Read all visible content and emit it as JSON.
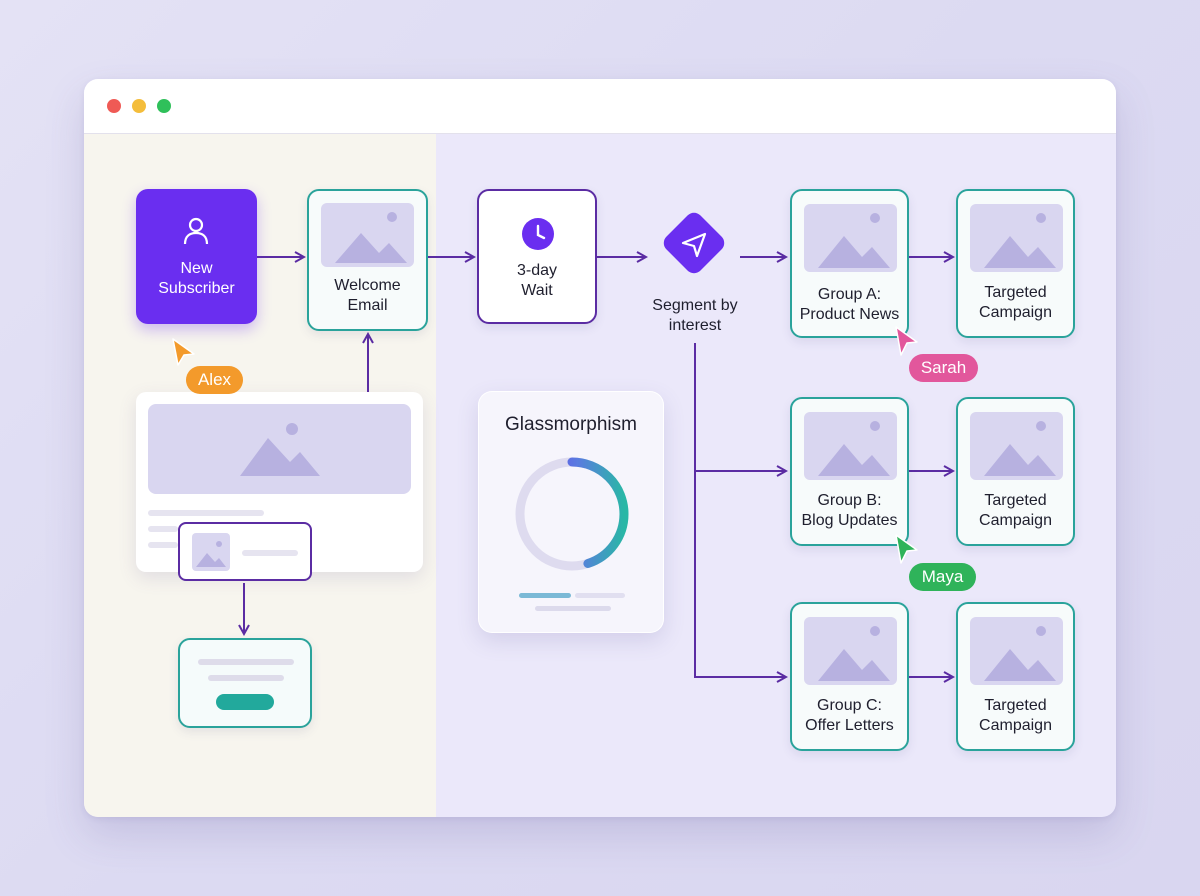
{
  "window": {
    "controls": [
      "close",
      "minimize",
      "maximize"
    ],
    "colors": {
      "close": "#ef5a55",
      "minimize": "#f4bd3b",
      "maximize": "#2fc05a"
    }
  },
  "flow": {
    "start_node": {
      "label_line1": "New",
      "label_line2": "Subscriber",
      "icon": "user-icon",
      "color": "#6a2ef0"
    },
    "welcome_email": {
      "label_line1": "Welcome",
      "label_line2": "Email",
      "icon": "image-placeholder-icon"
    },
    "wait_node": {
      "label_line1": "3-day",
      "label_line2": "Wait",
      "icon": "clock-icon"
    },
    "segment_node": {
      "label_line1": "Segment by",
      "label_line2": "interest",
      "icon": "navigation-arrow-icon"
    },
    "groups": [
      {
        "label_line1": "Group A:",
        "label_line2": "Product News",
        "campaign_line1": "Targeted",
        "campaign_line2": "Campaign"
      },
      {
        "label_line1": "Group B:",
        "label_line2": "Blog Updates",
        "campaign_line1": "Targeted",
        "campaign_line2": "Campaign"
      },
      {
        "label_line1": "Group C:",
        "label_line2": "Offer Letters",
        "campaign_line1": "Targeted",
        "campaign_line2": "Campaign"
      }
    ]
  },
  "collaborators": [
    {
      "name": "Alex",
      "color": "#f39a2b"
    },
    {
      "name": "Sarah",
      "color": "#e2579c"
    },
    {
      "name": "Maya",
      "color": "#2fb35a"
    }
  ],
  "glass_card": {
    "title": "Glassmorphism",
    "progress": 0.45
  },
  "colors": {
    "accent": "#6a2ef0",
    "teal": "#2aa39b",
    "connector": "#5b2ca3"
  }
}
